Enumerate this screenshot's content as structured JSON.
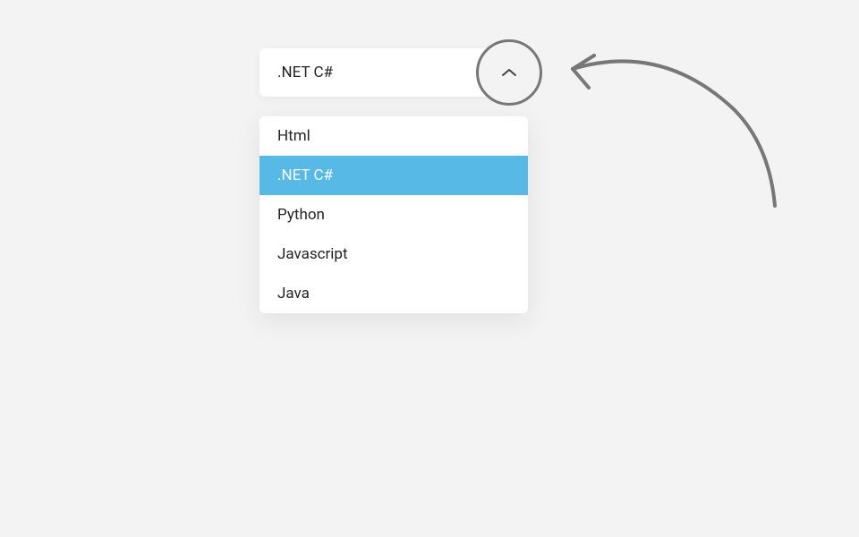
{
  "dropdown": {
    "selected": ".NET C#",
    "options": [
      {
        "label": "Html",
        "selected": false
      },
      {
        "label": ".NET C#",
        "selected": true
      },
      {
        "label": "Python",
        "selected": false
      },
      {
        "label": "Javascript",
        "selected": false
      },
      {
        "label": "Java",
        "selected": false
      }
    ]
  },
  "colors": {
    "background": "#f3f3f3",
    "card": "#ffffff",
    "selected_bg": "#57b9e6",
    "selected_text": "#ffffff",
    "text": "#222222",
    "circle_border": "#777777",
    "annotation": "#777777"
  }
}
